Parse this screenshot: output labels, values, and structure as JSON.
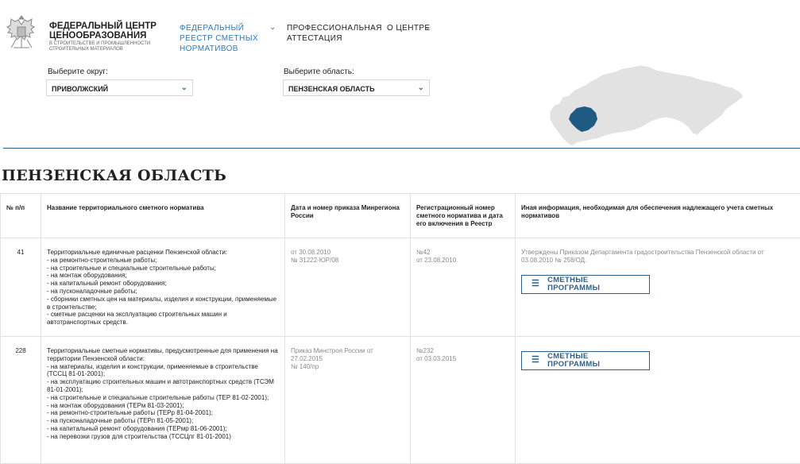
{
  "logo": {
    "title": "ФЕДЕРАЛЬНЫЙ ЦЕНТР ЦЕНООБРАЗОВАНИЯ",
    "subtitle": "В СТРОИТЕЛЬСТВЕ И ПРОМЫШЛЕННОСТИ СТРОИТЕЛЬНЫХ МАТЕРИАЛОВ"
  },
  "nav": [
    {
      "label": "ФЕДЕРАЛЬНЫЙ РЕЕСТР СМЕТНЫХ НОРМАТИВОВ",
      "active": true
    },
    {
      "label": "ПРОФЕССИОНАЛЬНАЯ АТТЕСТАЦИЯ",
      "active": false
    },
    {
      "label": "О ЦЕНТРЕ",
      "active": false
    }
  ],
  "filters": {
    "district_label": "Выберите округ:",
    "district_value": "ПРИВОЛЖСКИЙ",
    "region_label": "Выберите область:",
    "region_value": "ПЕНЗЕНСКАЯ ОБЛАСТЬ"
  },
  "colors": {
    "accent": "#2a7bbf",
    "dark_blue": "#2b5f8b",
    "map_grey": "#e2e2e2",
    "map_highlight": "#1e5a82"
  },
  "page_title": "ПЕНЗЕНСКАЯ ОБЛАСТЬ",
  "table": {
    "headers": [
      "№ п/п",
      "Название территориального сметного норматива",
      "Дата и номер приказа Минрегиона России",
      "Регистрационный номер сметного норматива и дата его включения в Реестр",
      "Иная информация, необходимая для обеспечения надлежащего учета сметных нормативов"
    ],
    "rows": [
      {
        "num": "41",
        "name_lines": [
          "Территориальные единичные расценки Пензенской области:",
          "- на ремонтно-строительные работы;",
          "- на строительные и специальные строительные работы;",
          "- на монтаж оборудования;",
          "- на капитальный ремонт оборудования;",
          "- на пусконаладочные работы;",
          "- сборники сметных цен на материалы, изделия и конструкции, применяемые в строительстве;",
          "- сметные расценки на эксплуатацию строительных машин и автотранспортных средств."
        ],
        "order": "от 30.08.2010\n№ 31222-ЮР/08",
        "reg": "№42\nот 23.08.2010",
        "info": "Утверждены Приказом Департамента градостроительства Пензенской области от 03.08.2010 № 258/ОД.",
        "button": "СМЕТНЫЕ ПРОГРАММЫ"
      },
      {
        "num": "228",
        "name_lines": [
          "Территориальные сметные нормативы, предусмотренные для применения на территории Пензенской области:",
          " - на материалы, изделия и конструкции, применяемые в строительстве (ТССЦ 81-01-2001);",
          " - на эксплуатацию строительных машин и автотранспортных средств (ТСЭМ 81-01-2001);",
          " - на строительные и специальные строительные работы (ТЕР 81-02-2001);",
          " - на монтаж оборудования (ТЕРм 81-03-2001);",
          " - на ремонтно-строительные работы (ТЕРр 81-04-2001);",
          " - на пусконаладочные работы (ТЕРп 81-05-2001);",
          " - на капитальный ремонт оборудования (ТЕРмр 81-06-2001);",
          " - на перевозки грузов для строительства (ТССЦпг 81-01-2001)"
        ],
        "order": "Приказ Минстроя России от 27.02.2015\n№ 140/пр",
        "reg": "№232\nот 03.03.2015",
        "info": "",
        "button": "СМЕТНЫЕ ПРОГРАММЫ"
      }
    ]
  }
}
